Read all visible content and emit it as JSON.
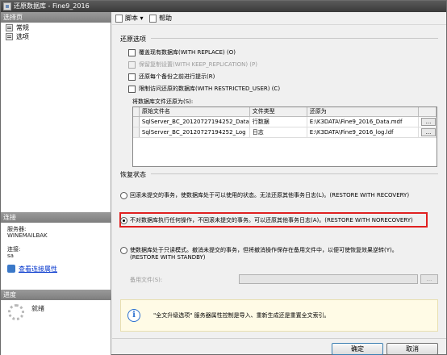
{
  "window": {
    "title": "还原数据库 - Fine9_2016"
  },
  "left_pane": {
    "select_page_header": "选择页",
    "nav_items": [
      {
        "label": "常规",
        "icon": "page-icon"
      },
      {
        "label": "选项",
        "icon": "page-icon"
      }
    ],
    "connection_header": "连接",
    "server_label": "服务器:",
    "server_value": "WINEMAILBAK",
    "connection_label": "连接:",
    "connection_value": "sa",
    "view_connection_link": "查看连接属性",
    "progress_header": "进度",
    "progress_status": "就绪"
  },
  "toolbar": {
    "script_label": "脚本",
    "help_label": "帮助"
  },
  "restore_options": {
    "title": "还原选项",
    "checkboxes": [
      {
        "label": "覆盖现有数据库(WITH REPLACE) (O)",
        "checked": false,
        "enabled": true
      },
      {
        "label": "保留复制设置(WITH KEEP_REPLICATION) (P)",
        "checked": false,
        "enabled": false
      },
      {
        "label": "还原每个备份之前进行提示(R)",
        "checked": false,
        "enabled": true
      },
      {
        "label": "限制访问还原的数据库(WITH RESTRICTED_USER) (C)",
        "checked": false,
        "enabled": true
      }
    ],
    "files_label": "将数据库文件还原为(S):",
    "columns": [
      "原始文件名",
      "文件类型",
      "还原为"
    ],
    "rows": [
      {
        "original": "SqlServer_BC_20120727194252_Data",
        "type": "行数据",
        "restore_as": "E:\\K3DATA\\Fine9_2016_Data.mdf"
      },
      {
        "original": "SqlServer_BC_20120727194252_Log",
        "type": "日志",
        "restore_as": "E:\\K3DATA\\Fine9_2016_log.ldf"
      }
    ],
    "browse_label": "..."
  },
  "recovery_state": {
    "title": "恢复状态",
    "options": [
      {
        "label": "回滚未提交的事务，使数据库处于可以使用的状态。无法还原其他事务日志(L)。(RESTORE WITH RECOVERY)",
        "selected": false
      },
      {
        "label": "不对数据库执行任何操作，不回滚未提交的事务。可以还原其他事务日志(A)。(RESTORE WITH NORECOVERY)",
        "selected": true
      },
      {
        "label_line1": "使数据库处于只读模式。撤消未提交的事务，但将撤消操作保存在备用文件中，以便可使恢复效果逆转(Y)。",
        "label_line2": "(RESTORE WITH STANDBY)",
        "selected": false
      }
    ],
    "standby_file_label": "备用文件(S):",
    "standby_file_value": "",
    "standby_browse_label": "..."
  },
  "info": {
    "message": "\"全文升级选项\" 服务器属性控制是导入、重新生成还是重置全文索引。"
  },
  "footer": {
    "ok_label": "确定",
    "cancel_label": "取消"
  },
  "colors": {
    "highlight_border": "#e02020",
    "link": "#0033cc"
  }
}
